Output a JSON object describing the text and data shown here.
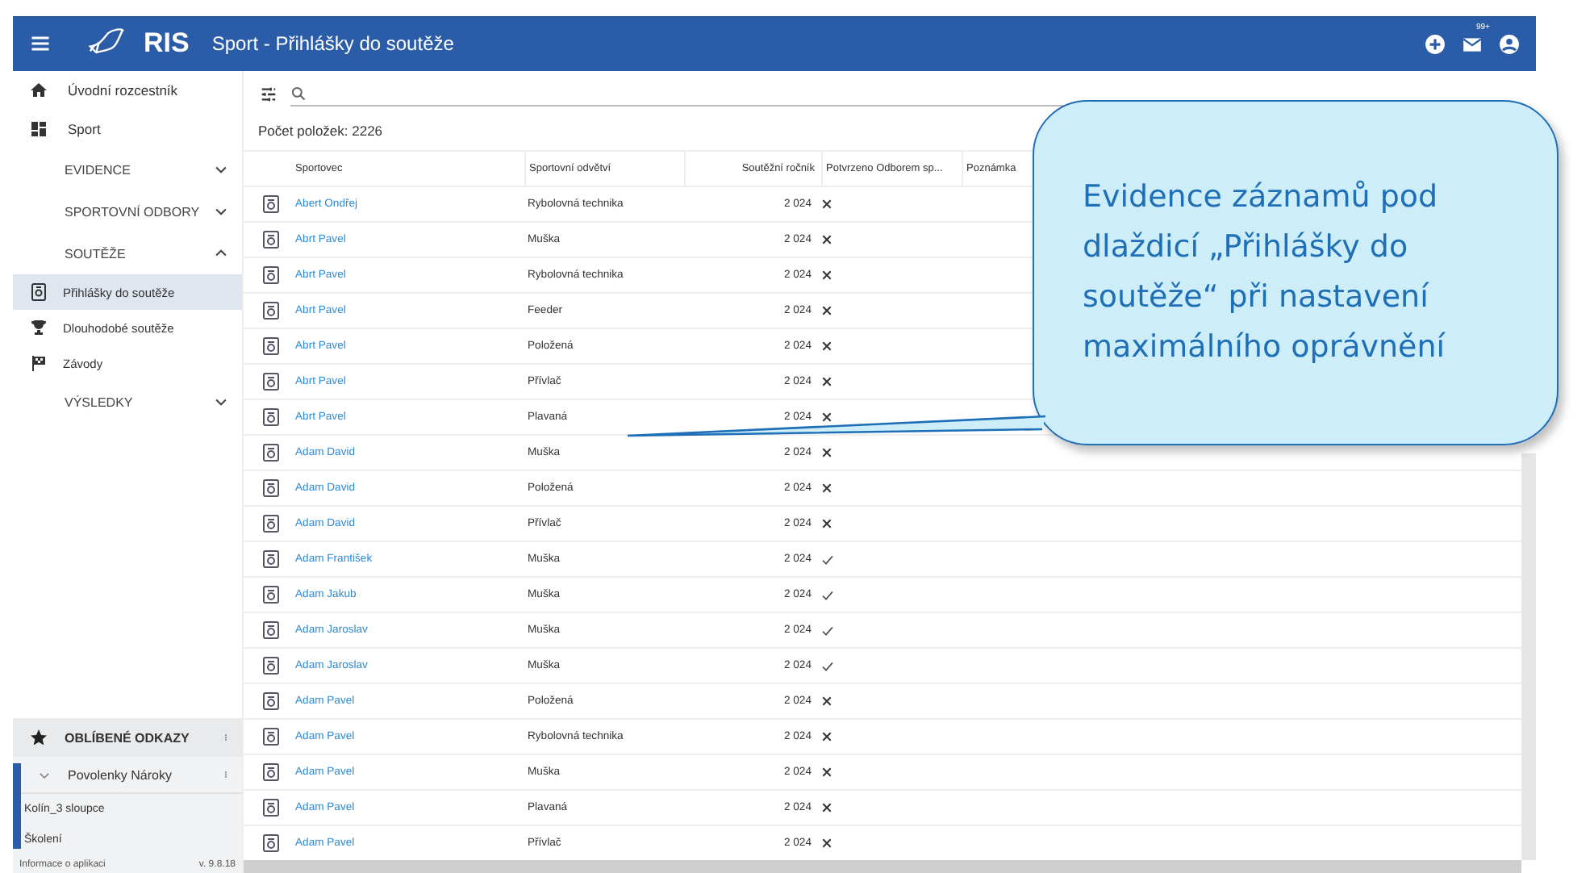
{
  "app_bar": {
    "logo": "RIS",
    "title": "Sport - Přihlášky do soutěže",
    "mail_badge": "99+"
  },
  "sidebar": {
    "items": [
      {
        "kind": "link",
        "label": "Úvodní rozcestník",
        "selected": false
      },
      {
        "kind": "link",
        "label": "Sport",
        "selected": false
      },
      {
        "kind": "section",
        "label": "EVIDENCE",
        "expanded": false
      },
      {
        "kind": "section",
        "label": "SPORTOVNÍ ODBORY",
        "expanded": false
      },
      {
        "kind": "section",
        "label": "SOUTĚŽE",
        "expanded": true
      },
      {
        "kind": "sub",
        "label": "Přihlášky do soutěže",
        "selected": true
      },
      {
        "kind": "sub",
        "label": "Dlouhodobé soutěže",
        "selected": false
      },
      {
        "kind": "sub",
        "label": "Závody",
        "selected": false
      },
      {
        "kind": "section",
        "label": "VÝSLEDKY",
        "expanded": false
      }
    ],
    "favorites": {
      "title": "OBLÍBENÉ ODKAZY",
      "group": {
        "label": "Povolenky Nároky",
        "expanded": true
      },
      "links": [
        "Kolín_3 sloupce",
        "Školení"
      ]
    },
    "footer": {
      "info": "Informace o aplikaci",
      "version": "v. 9.8.18"
    }
  },
  "list": {
    "count": "Počet položek: 2226",
    "columns": [
      "Sportovec",
      "Sportovní odvětví",
      "Soutěžní ročník",
      "Potvrzeno Odborem sp...",
      "Poznámka"
    ],
    "rows": [
      {
        "athlete": "Abert Ondřej",
        "discipline": "Rybolovná technika",
        "year": "2 024",
        "confirmed": false
      },
      {
        "athlete": "Abrt Pavel",
        "discipline": "Muška",
        "year": "2 024",
        "confirmed": false
      },
      {
        "athlete": "Abrt Pavel",
        "discipline": "Rybolovná technika",
        "year": "2 024",
        "confirmed": false
      },
      {
        "athlete": "Abrt Pavel",
        "discipline": "Feeder",
        "year": "2 024",
        "confirmed": false
      },
      {
        "athlete": "Abrt Pavel",
        "discipline": "Položená",
        "year": "2 024",
        "confirmed": false
      },
      {
        "athlete": "Abrt Pavel",
        "discipline": "Přívlač",
        "year": "2 024",
        "confirmed": false
      },
      {
        "athlete": "Abrt Pavel",
        "discipline": "Plavaná",
        "year": "2 024",
        "confirmed": false
      },
      {
        "athlete": "Adam David",
        "discipline": "Muška",
        "year": "2 024",
        "confirmed": false
      },
      {
        "athlete": "Adam David",
        "discipline": "Položená",
        "year": "2 024",
        "confirmed": false
      },
      {
        "athlete": "Adam David",
        "discipline": "Přívlač",
        "year": "2 024",
        "confirmed": false
      },
      {
        "athlete": "Adam František",
        "discipline": "Muška",
        "year": "2 024",
        "confirmed": true
      },
      {
        "athlete": "Adam Jakub",
        "discipline": "Muška",
        "year": "2 024",
        "confirmed": true
      },
      {
        "athlete": "Adam Jaroslav",
        "discipline": "Muška",
        "year": "2 024",
        "confirmed": true
      },
      {
        "athlete": "Adam Jaroslav",
        "discipline": "Muška",
        "year": "2 024",
        "confirmed": true
      },
      {
        "athlete": "Adam Pavel",
        "discipline": "Položená",
        "year": "2 024",
        "confirmed": false
      },
      {
        "athlete": "Adam Pavel",
        "discipline": "Rybolovná technika",
        "year": "2 024",
        "confirmed": false
      },
      {
        "athlete": "Adam Pavel",
        "discipline": "Muška",
        "year": "2 024",
        "confirmed": false
      },
      {
        "athlete": "Adam Pavel",
        "discipline": "Plavaná",
        "year": "2 024",
        "confirmed": false
      },
      {
        "athlete": "Adam Pavel",
        "discipline": "Přívlač",
        "year": "2 024",
        "confirmed": false
      }
    ]
  },
  "callout": {
    "text": "Evidence záznamů pod dlaždicí „Přihlášky do soutěže“ při nastavení maximálního oprávnění"
  }
}
